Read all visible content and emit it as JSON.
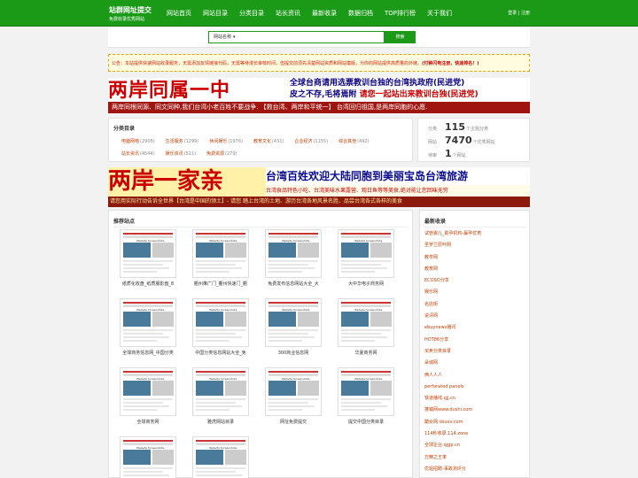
{
  "header": {
    "logo_title": "站群网址提交",
    "logo_subtitle": "免费收录优秀网站",
    "nav": [
      "网站首页",
      "网站目录",
      "分类目录",
      "站长资讯",
      "最新收录",
      "数据归档",
      "TOP排行榜",
      "关于我们"
    ],
    "account": "登录 | 注册",
    "brand_color": "#1a9a17"
  },
  "search": {
    "select_value": "网站名称",
    "select_icon": "chevron-down-icon",
    "button_label": "搜索"
  },
  "notice": {
    "text": "公告：本站提供快速网站收录服务，无需添加友情链接代码，无需等待漫长审核时间，但提交前须先清楚网站资质和网站模版，为你的网站提供高质量的外链。",
    "highlight": "(付钟闪电注册，快速排名！)"
  },
  "banner1": {
    "big": "两岸同属一中",
    "line1": "全球台商请用选票教训台独的台湾执政府(民进党)",
    "line2a": "皮之不存,毛将焉附",
    "line2b": "请您一起站出来教训台独(民进党)",
    "strip": "两岸同根同源、同文同种,我们台湾小老百姓不要战争.   【救台湾、两岸和平统一】  台湾回归祖国,是两岸同胞的心愿."
  },
  "categories": {
    "title": "分类目录",
    "row1": [
      {
        "name": "电脑网络",
        "count": "(2905)"
      },
      {
        "name": "生活服务",
        "count": "(1299)"
      },
      {
        "name": "休闲娱乐",
        "count": "(1976)"
      },
      {
        "name": "教育文化",
        "count": "(431)"
      },
      {
        "name": "企业经济",
        "count": "(1155)"
      },
      {
        "name": "综合其他",
        "count": "(492)"
      }
    ],
    "row2": [
      {
        "name": "站长资讯",
        "count": "(4544)"
      },
      {
        "name": "娱乐资讯",
        "count": "(511)"
      },
      {
        "name": "免费资源",
        "count": "(279)"
      }
    ]
  },
  "stats": {
    "rows": [
      {
        "label": "分类",
        "value": "115",
        "unit": "个主题分类"
      },
      {
        "label": "网站",
        "value": "7470",
        "unit": "个优秀网站"
      },
      {
        "label": "待审",
        "value": "1",
        "unit": "个网站"
      }
    ]
  },
  "banner2": {
    "big": "两岸一家亲",
    "line1": "台湾百姓欢迎大陆同胞到美丽宝岛台湾旅游",
    "line2": "台湾食品特色小吃、台湾美味水果露营、观日鱼等等美食,绝对能让您回味无穷",
    "strip": "请您用实际行动告诉全世界【台湾是中国的领土】- 请您 踏上台湾的土地、游历台湾各地风景名胜、品尝台湾各式各样的美食"
  },
  "recommended": {
    "title": "推荐站点",
    "thumb_caption": "Website Screenshots",
    "sites": [
      "纸质化收盘_纸质服影盘_8",
      "衢州推广门_衢州快速门_衢",
      "免费发布信息网站大全_大",
      "大中华电子商务网",
      "全球商务信息网_中国分类",
      "中国分类信息网站大全_免",
      "300商业信息网",
      "华夏商务网",
      "全球商务网",
      "雅虎网站目录",
      "网址免费提交",
      "提交中国分类目录",
      "",
      ""
    ]
  },
  "latest": {
    "title": "最新收录",
    "items": [
      "试管婴儿_助孕机构-赢孕优育",
      "圣罗兰原叶网",
      "教学网",
      "教育网",
      "ECOSO分享",
      "娱乐网",
      "名店街",
      "说评网",
      "ebuynews播讯",
      "HOT86分享",
      "买卖分类目录",
      "朵城网",
      "俩人人人",
      "perforated panels",
      "铁道播线.qjj.cn",
      "蓬镇网www.dushi.com",
      "黯女网.dsuov.com",
      "114秒收录.114.zone",
      "全球企业.qjgp.cn",
      "万精之王率",
      "优姐招聘-事故测评分"
    ]
  }
}
